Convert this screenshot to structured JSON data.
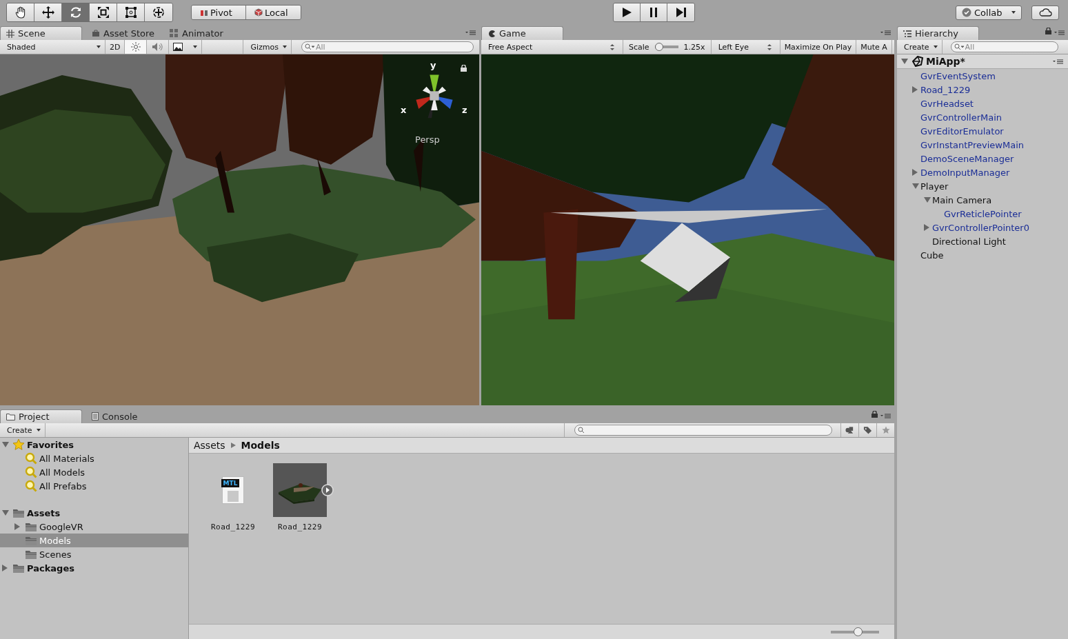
{
  "toolbar": {
    "tools": [
      {
        "kind": "hand",
        "selected": false
      },
      {
        "kind": "move",
        "selected": false
      },
      {
        "kind": "rotate",
        "selected": true
      },
      {
        "kind": "scale",
        "selected": false
      },
      {
        "kind": "rect",
        "selected": false
      },
      {
        "kind": "transform",
        "selected": false
      }
    ],
    "pivot": "Pivot",
    "local": "Local",
    "playback": [
      {
        "kind": "play"
      },
      {
        "kind": "pause"
      },
      {
        "kind": "step"
      }
    ],
    "collab": "Collab"
  },
  "scene": {
    "tabs": [
      {
        "label": "Scene",
        "kind": "grid",
        "selected": true
      },
      {
        "label": "Asset Store",
        "kind": "store",
        "selected": false
      },
      {
        "label": "Animator",
        "kind": "animator",
        "selected": false
      }
    ],
    "shading": "Shaded",
    "mode_2d": "2D",
    "lighting": true,
    "audio": false,
    "gizmos": "Gizmos",
    "search": {
      "placeholder": "All"
    },
    "gizmo": {
      "y": "y",
      "x": "x",
      "z": "z",
      "projection": "Persp"
    }
  },
  "game": {
    "tabs": [
      {
        "label": "Game",
        "kind": "game",
        "selected": true
      }
    ],
    "aspect": "Free Aspect",
    "scale_label": "Scale",
    "scale": {
      "level": 0.03
    },
    "scale_reading": "1.25x",
    "eye": "Left Eye",
    "maximize": "Maximize On Play",
    "mute": "Mute A"
  },
  "hierarchy": {
    "tab": "Hierarchy",
    "create": "Create",
    "search": {
      "placeholder": "All"
    },
    "scene": "MiApp*",
    "items": [
      {
        "name": "GvrEventSystem",
        "prefab": true
      },
      {
        "name": "Road_1229",
        "prefab": true,
        "expanded": false
      },
      {
        "name": "GvrHeadset",
        "prefab": true
      },
      {
        "name": "GvrControllerMain",
        "prefab": true
      },
      {
        "name": "GvrEditorEmulator",
        "prefab": true
      },
      {
        "name": "GvrInstantPreviewMain",
        "prefab": true
      },
      {
        "name": "DemoSceneManager",
        "prefab": true
      },
      {
        "name": "DemoInputManager",
        "prefab": true,
        "expanded": false
      },
      {
        "name": "Player",
        "prefab": false,
        "expanded": true,
        "children": [
          {
            "name": "Main Camera",
            "prefab": false,
            "expanded": true,
            "children": [
              {
                "name": "GvrReticlePointer",
                "prefab": true
              }
            ]
          },
          {
            "name": "GvrControllerPointer0",
            "prefab": true,
            "expanded": false
          },
          {
            "name": "Directional Light",
            "prefab": false
          }
        ]
      },
      {
        "name": "Cube",
        "prefab": false
      }
    ]
  },
  "project": {
    "tabs": [
      {
        "label": "Project",
        "kind": "folder",
        "selected": true
      },
      {
        "label": "Console",
        "kind": "console",
        "selected": false
      }
    ],
    "create": "Create",
    "tree": [
      {
        "name": "Favorites",
        "kind": "star",
        "expanded": true,
        "selected": false,
        "children": [
          {
            "name": "All Materials",
            "kind": "search",
            "selected": false
          },
          {
            "name": "All Models",
            "kind": "search",
            "selected": false
          },
          {
            "name": "All Prefabs",
            "kind": "search",
            "selected": false
          }
        ]
      },
      {
        "name": "Assets",
        "kind": "folder",
        "expanded": true,
        "selected": false,
        "children": [
          {
            "name": "GoogleVR",
            "kind": "folder",
            "expanded": false,
            "selected": false
          },
          {
            "name": "Models",
            "kind": "folder",
            "selected": true
          },
          {
            "name": "Scenes",
            "kind": "folder",
            "selected": false
          }
        ]
      },
      {
        "name": "Packages",
        "kind": "folder",
        "expanded": false,
        "selected": false
      }
    ],
    "breadcrumb": [
      "Assets",
      "Models"
    ],
    "assets": [
      {
        "name": "Road_1229",
        "kind": "material",
        "badge": "MTL"
      },
      {
        "name": "Road_1229",
        "kind": "model"
      }
    ],
    "zoom": {
      "level": 0.58
    }
  }
}
